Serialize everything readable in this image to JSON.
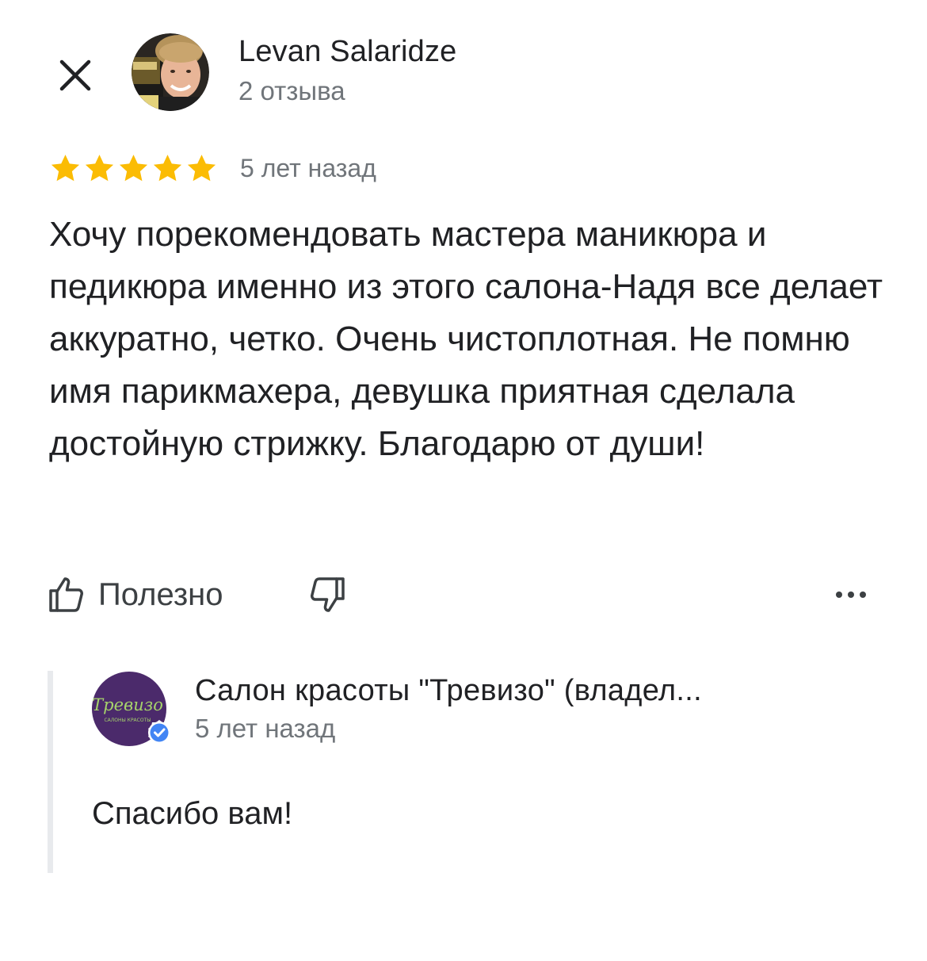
{
  "review": {
    "author": {
      "name": "Levan Salaridze",
      "reviews_count": "2 отзыва"
    },
    "rating": 5,
    "rating_max": 5,
    "date": "5 лет назад",
    "text": "Хочу порекомендовать мастера маникюра и педикюра именно из этого салона-Надя все делает аккуратно, четко. Очень чистоплотная. Не помню имя парикмахера, девушка приятная сделала достойную стрижку. Благодарю от души!"
  },
  "actions": {
    "helpful_label": "Полезно",
    "close_icon": "close-icon",
    "like_icon": "thumb-up-icon",
    "dislike_icon": "thumb-down-icon",
    "more_icon": "more-horizontal-icon"
  },
  "owner_reply": {
    "name": "Салон красоты \"Тревизо\" (владел...",
    "date": "5 лет назад",
    "text": "Спасибо вам!",
    "logo_text": "Тревизо",
    "logo_subtext": "САЛОНЫ КРАСОТЫ",
    "verified_icon": "verified-check-icon"
  },
  "colors": {
    "star": "#FBBC04",
    "text_primary": "#202124",
    "text_secondary": "#70757a",
    "owner_logo_bg": "#4b2a6b",
    "owner_logo_text": "#a6d36b",
    "verified_badge": "#4285f4"
  }
}
